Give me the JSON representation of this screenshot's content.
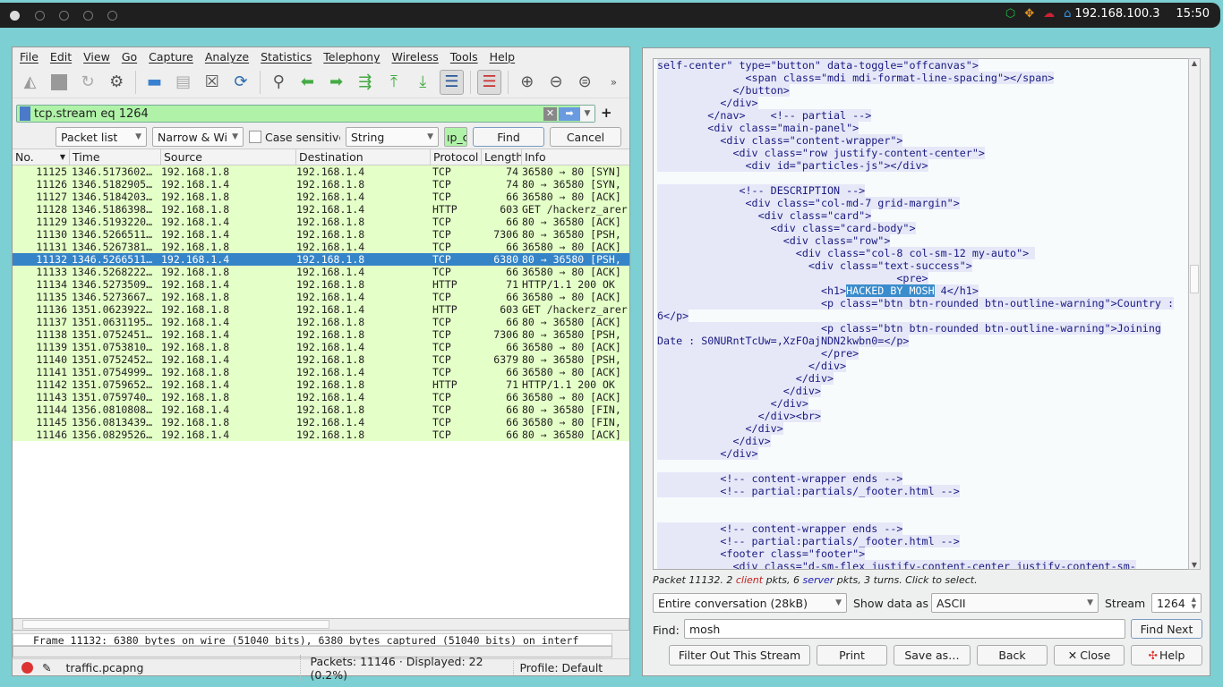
{
  "topbar": {
    "ip": "192.168.100.3",
    "time": "15:50",
    "colors": {
      "box": "#22bb44",
      "crosshair": "#ee9922",
      "cloud": "#cc2233",
      "home": "#3399ee"
    }
  },
  "menu": [
    "File",
    "Edit",
    "View",
    "Go",
    "Capture",
    "Analyze",
    "Statistics",
    "Telephony",
    "Wireless",
    "Tools",
    "Help"
  ],
  "filter": {
    "value": "tcp.stream eq 1264",
    "plus": "+"
  },
  "findbar": {
    "scope": "Packet list",
    "charset": "Narrow & Wi",
    "case_label": "Case sensitive",
    "case_checked": false,
    "type": "String",
    "search": "ıp_c",
    "find": "Find",
    "cancel": "Cancel"
  },
  "columns": [
    "No.",
    "Time",
    "Source",
    "Destination",
    "Protocol",
    "Length",
    "Info"
  ],
  "packets": [
    [
      "11125",
      "1346.5173602…",
      "192.168.1.8",
      "192.168.1.4",
      "TCP",
      "74",
      "36580 → 80 [SYN]"
    ],
    [
      "11126",
      "1346.5182905…",
      "192.168.1.4",
      "192.168.1.8",
      "TCP",
      "74",
      "80 → 36580 [SYN,"
    ],
    [
      "11127",
      "1346.5184203…",
      "192.168.1.8",
      "192.168.1.4",
      "TCP",
      "66",
      "36580 → 80 [ACK]"
    ],
    [
      "11128",
      "1346.5186398…",
      "192.168.1.8",
      "192.168.1.4",
      "HTTP",
      "603",
      "GET /hackerz_arer"
    ],
    [
      "11129",
      "1346.5193220…",
      "192.168.1.4",
      "192.168.1.8",
      "TCP",
      "66",
      "80 → 36580 [ACK]"
    ],
    [
      "11130",
      "1346.5266511…",
      "192.168.1.4",
      "192.168.1.8",
      "TCP",
      "7306",
      "80 → 36580 [PSH,"
    ],
    [
      "11131",
      "1346.5267381…",
      "192.168.1.8",
      "192.168.1.4",
      "TCP",
      "66",
      "36580 → 80 [ACK]"
    ],
    [
      "11132",
      "1346.5266511…",
      "192.168.1.4",
      "192.168.1.8",
      "TCP",
      "6380",
      "80 → 36580 [PSH,"
    ],
    [
      "11133",
      "1346.5268222…",
      "192.168.1.8",
      "192.168.1.4",
      "TCP",
      "66",
      "36580 → 80 [ACK]"
    ],
    [
      "11134",
      "1346.5273509…",
      "192.168.1.4",
      "192.168.1.8",
      "HTTP",
      "71",
      "HTTP/1.1 200 OK"
    ],
    [
      "11135",
      "1346.5273667…",
      "192.168.1.8",
      "192.168.1.4",
      "TCP",
      "66",
      "36580 → 80 [ACK]"
    ],
    [
      "11136",
      "1351.0623922…",
      "192.168.1.8",
      "192.168.1.4",
      "HTTP",
      "603",
      "GET /hackerz_arer"
    ],
    [
      "11137",
      "1351.0631195…",
      "192.168.1.4",
      "192.168.1.8",
      "TCP",
      "66",
      "80 → 36580 [ACK]"
    ],
    [
      "11138",
      "1351.0752451…",
      "192.168.1.4",
      "192.168.1.8",
      "TCP",
      "7306",
      "80 → 36580 [PSH,"
    ],
    [
      "11139",
      "1351.0753810…",
      "192.168.1.8",
      "192.168.1.4",
      "TCP",
      "66",
      "36580 → 80 [ACK]"
    ],
    [
      "11140",
      "1351.0752452…",
      "192.168.1.4",
      "192.168.1.8",
      "TCP",
      "6379",
      "80 → 36580 [PSH,"
    ],
    [
      "11141",
      "1351.0754999…",
      "192.168.1.8",
      "192.168.1.4",
      "TCP",
      "66",
      "36580 → 80 [ACK]"
    ],
    [
      "11142",
      "1351.0759652…",
      "192.168.1.4",
      "192.168.1.8",
      "HTTP",
      "71",
      "HTTP/1.1 200 OK"
    ],
    [
      "11143",
      "1351.0759740…",
      "192.168.1.8",
      "192.168.1.4",
      "TCP",
      "66",
      "36580 → 80 [ACK]"
    ],
    [
      "11144",
      "1356.0810808…",
      "192.168.1.4",
      "192.168.1.8",
      "TCP",
      "66",
      "80 → 36580 [FIN,"
    ],
    [
      "11145",
      "1356.0813439…",
      "192.168.1.8",
      "192.168.1.4",
      "TCP",
      "66",
      "36580 → 80 [FIN,"
    ],
    [
      "11146",
      "1356.0829526…",
      "192.168.1.4",
      "192.168.1.8",
      "TCP",
      "66",
      "80 → 36580 [ACK]"
    ]
  ],
  "selected_packet": "11132",
  "detail": "Frame 11132: 6380 bytes on wire (51040 bits), 6380 bytes captured (51040 bits) on interf",
  "status": {
    "file": "traffic.pcapng",
    "packets": "Packets: 11146 · Displayed: 22 (0.2%)",
    "profile": "Profile: Default"
  },
  "stream": {
    "lines": [
      "self-center\" type=\"button\" data-toggle=\"offcanvas\">",
      "              <span class=\"mdi mdi-format-line-spacing\"></span>",
      "            </button>",
      "          </div>",
      "        </nav>    <!-- partial -->",
      "        <div class=\"main-panel\">",
      "          <div class=\"content-wrapper\">",
      "            <div class=\"row justify-content-center\">",
      "              <div id=\"particles-js\"></div>",
      "",
      "             <!-- DESCRIPTION -->",
      "              <div class=\"col-md-7 grid-margin\">",
      "                <div class=\"card\">",
      "                  <div class=\"card-body\">",
      "                    <div class=\"row\">",
      "                      <div class=\"col-8 col-sm-12 my-auto\"> ",
      "                        <div class=\"text-success\">",
      "                                      <pre>",
      "__H1__",
      "                          <p class=\"btn btn-rounded btn-outline-warning\">Country :",
      "6</p>",
      "                          <p class=\"btn btn-rounded btn-outline-warning\">Joining",
      "Date : S0NURntTcUw=,XzFOajNDN2kwbn0=</p>",
      "                          </pre>",
      "                        </div>",
      "                      </div>",
      "                    </div>",
      "                  </div>",
      "                </div><br>",
      "              </div>",
      "            </div>",
      "          </div>",
      "",
      "          <!-- content-wrapper ends -->",
      "          <!-- partial:partials/_footer.html -->",
      "",
      "",
      "          <!-- content-wrapper ends -->",
      "          <!-- partial:partials/_footer.html -->",
      "          <footer class=\"footer\">",
      "            <div class=\"d-sm-flex justify-content-center justify-content-sm-"
    ],
    "h1_prefix": "                          <h1>",
    "h1_match": "HACKED BY MOSH",
    "h1_suffix": " 4</h1>",
    "info": {
      "a": "Packet 11132. 2 ",
      "client": "client",
      "b": " pkts, 6 ",
      "server": "server",
      "c": " pkts, 3 turns. Click to select."
    },
    "conversation": "Entire conversation (28kB)",
    "show_label": "Show data as",
    "format": "ASCII",
    "stream_label": "Stream",
    "stream_no": "1264",
    "find_label": "Find:",
    "find_value": "mosh",
    "find_next": "Find Next",
    "buttons": [
      "Filter Out This Stream",
      "Print",
      "Save as…",
      "Back",
      "Close",
      "Help"
    ]
  }
}
